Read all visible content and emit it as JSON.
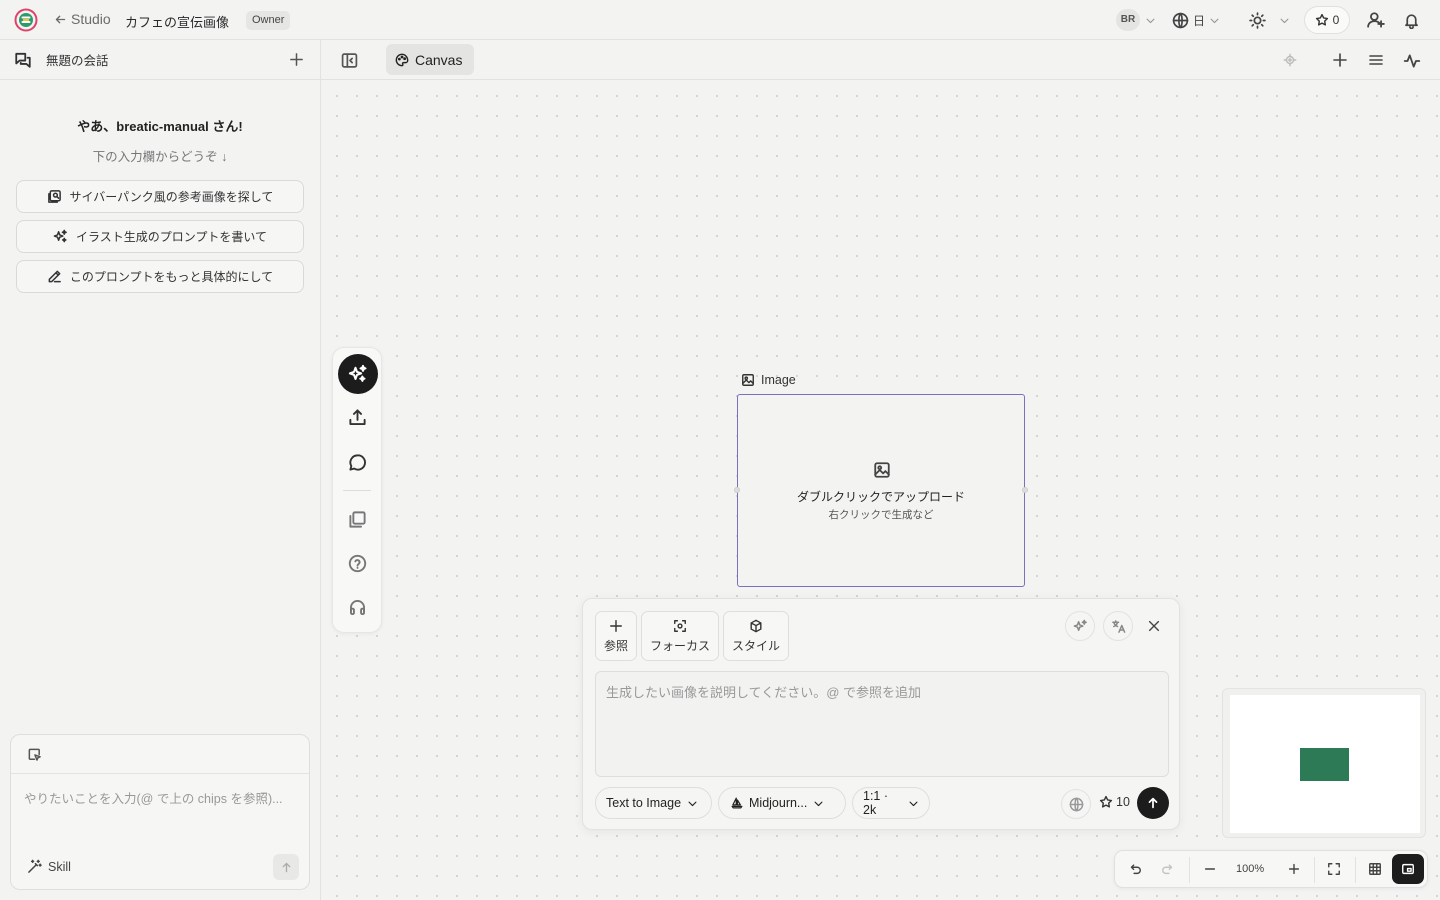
{
  "topbar": {
    "back_label": "Studio",
    "project_title": "カフェの宣伝画像",
    "role_badge": "Owner",
    "user_initials": "BR",
    "language": "日",
    "credits": "0"
  },
  "sidebar": {
    "conversation_title": "無題の会話",
    "greeting": "やあ、breatic-manual さん!",
    "greeting_sub": "下の入力欄からどうぞ ↓",
    "chips": [
      {
        "label": "サイバーパンク風の参考画像を探して",
        "icon": "image-search-icon"
      },
      {
        "label": "イラスト生成のプロンプトを書いて",
        "icon": "sparkles-icon"
      },
      {
        "label": "このプロンプトをもっと具体的にして",
        "icon": "pencil-icon"
      }
    ],
    "chat_placeholder": "やりたいことを入力(@ で上の chips を参照)...",
    "skill_label": "Skill"
  },
  "canvas": {
    "tab_label": "Canvas",
    "node": {
      "label": "Image",
      "title": "ダブルクリックでアップロード",
      "subtitle": "右クリックで生成など"
    }
  },
  "prompt_panel": {
    "buttons": [
      {
        "label": "参照",
        "icon": "plus-icon"
      },
      {
        "label": "フォーカス",
        "icon": "focus-icon"
      },
      {
        "label": "スタイル",
        "icon": "cube-icon"
      }
    ],
    "placeholder": "生成したい画像を説明してください。@ で参照を追加",
    "mode": "Text to Image",
    "model": "Midjourn...",
    "ratio": "1:1 · 2k",
    "cost": "10"
  },
  "zoom": {
    "level": "100%"
  },
  "colors": {
    "node_border": "#7b6fc0",
    "minimap_mark": "#2c7a56",
    "accent_dark": "#1c1c1c"
  }
}
